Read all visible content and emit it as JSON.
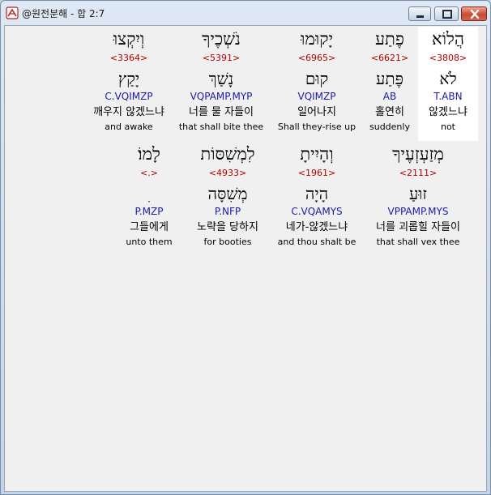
{
  "window": {
    "title": "@원전분해 - 합 2:7"
  },
  "rows": [
    [
      {
        "hebrew": "הֲלוֹא",
        "strong": "<3808>",
        "lemma": "לֹא",
        "parse": "T.ABN",
        "korean": "않겠느냐",
        "english": "not",
        "selected": true
      },
      {
        "hebrew": "פֶתַע",
        "strong": "<6621>",
        "lemma": "פֶּתַע",
        "parse": "AB",
        "korean": "홀연히",
        "english": "suddenly"
      },
      {
        "hebrew": "יָקוּמוּ",
        "strong": "<6965>",
        "lemma": "קוּם",
        "parse": "VQIMZP",
        "korean": "일어나지",
        "english": "Shall they-rise up"
      },
      {
        "hebrew": "נֹשְׁכֶיךָ",
        "strong": "<5391>",
        "lemma": "נָשַׁךְ",
        "parse": "VQPAMP.MYP",
        "korean": "너를 물 자들이",
        "english": "that shall bite thee"
      },
      {
        "hebrew": "וְיִקְצוּ",
        "strong": "<3364>",
        "lemma": "יָקַץ",
        "parse": "C.VQIMZP",
        "korean": "깨우지 않겠느냐",
        "english": "and awake"
      }
    ],
    [
      {
        "hebrew": "מְזַעְזְעֶיךָ",
        "strong": "<2111>",
        "lemma": "זוּעַ",
        "parse": "VPPAMP.MYS",
        "korean": "너를 괴롭힐 자들이",
        "english": "that shall vex thee"
      },
      {
        "hebrew": "וְהָיִיתָ",
        "strong": "<1961>",
        "lemma": "הָיָה",
        "parse": "C.VQAMYS",
        "korean": "네가-않겠느냐",
        "english": "and thou shalt be"
      },
      {
        "hebrew": "לִמְשִׁסּוֹת",
        "strong": "<4933>",
        "lemma": "מְשִׁסָּה",
        "parse": "P.NFP",
        "korean": "노략을 당하지",
        "english": "for booties"
      },
      {
        "hebrew": "לָמוֹ׃",
        "strong": "<.>",
        "lemma": "ִ",
        "parse": "P.MZP",
        "korean": "그들에게",
        "english": "unto them"
      }
    ]
  ]
}
